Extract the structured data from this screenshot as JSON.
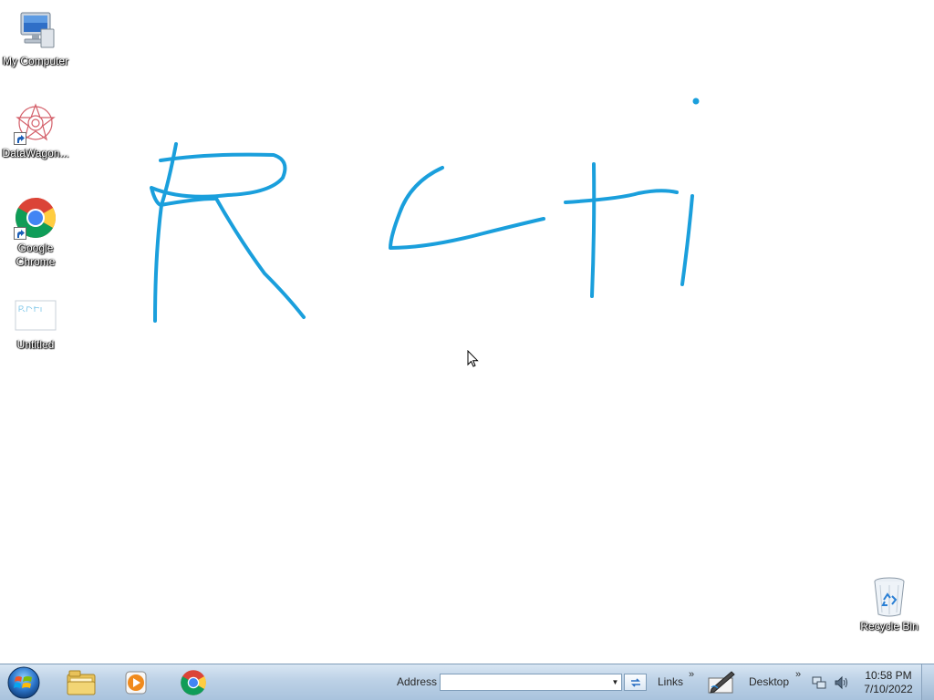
{
  "desktop": {
    "icons": [
      {
        "label": "My Computer"
      },
      {
        "label": "DataWagon..."
      },
      {
        "label": "Google Chrome"
      },
      {
        "label": "Untitled"
      },
      {
        "label": "Recycle Bin"
      }
    ],
    "ink_color": "#1a9fdc"
  },
  "taskbar": {
    "address_label": "Address",
    "address_value": "",
    "links_label": "Links",
    "desktop_label": "Desktop",
    "chevron": "»",
    "clock": {
      "time": "10:58 PM",
      "date": "7/10/2022"
    }
  },
  "icons": {
    "start": "windows-orb-icon",
    "explorer": "folder-icon",
    "media_player": "media-player-icon",
    "chrome": "chrome-icon",
    "go": "refresh-icon",
    "pen": "pen-tablet-icon",
    "network": "network-icon",
    "volume": "speaker-icon"
  }
}
